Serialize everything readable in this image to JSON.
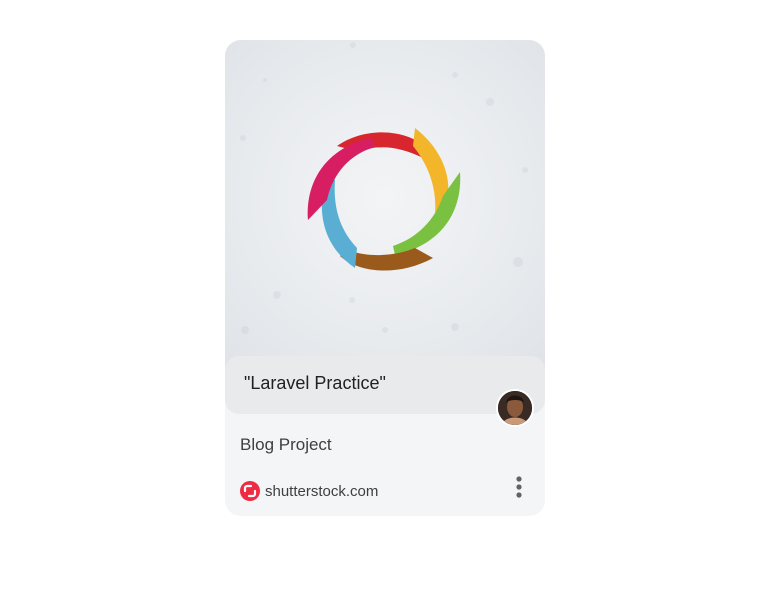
{
  "card": {
    "caption": "\"Laravel Practice\"",
    "title": "Blog Project",
    "source": {
      "domain": "shutterstock.com",
      "icon": "shutterstock-logo-icon",
      "icon_color": "#ee2b43"
    },
    "more_icon": "more-vertical-icon",
    "image_icon": "colorful-pinwheel-logo",
    "avatar_icon": "profile-avatar"
  },
  "colors": {
    "card_background": "#f4f5f7",
    "caption_background": "#e9eaec",
    "text_primary": "#202124",
    "text_secondary": "#3c4043"
  }
}
